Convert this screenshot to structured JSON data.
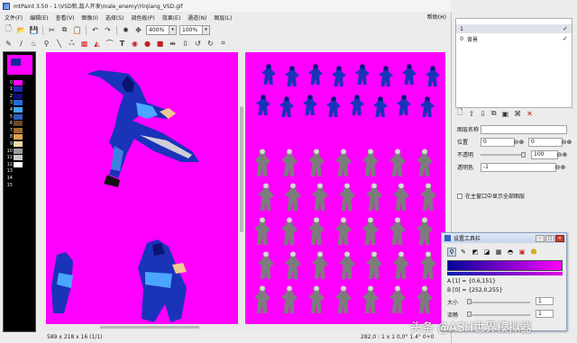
{
  "window": {
    "title": "mtPaint 3.50 - 1:\\VSD新,敌人开发\\male_enemy\\Yinjiang_VSD.gif",
    "help": "帮助(H)"
  },
  "menu": [
    "文件(F)",
    "编辑(E)",
    "查看(V)",
    "图像(I)",
    "选择(S)",
    "调色板(P)",
    "效果(E)",
    "通道(N)",
    "图层(L)"
  ],
  "toolbar": {
    "zoom_main": "400%",
    "zoom_view": "100%"
  },
  "palette": {
    "entries": [
      {
        "num": "0",
        "color": "#ff00ff"
      },
      {
        "num": "1",
        "color": "#1b2bb0"
      },
      {
        "num": "2",
        "color": "#0a0f7a"
      },
      {
        "num": "3",
        "color": "#1f6ee0"
      },
      {
        "num": "4",
        "color": "#43a4ff"
      },
      {
        "num": "5",
        "color": "#2f5fc0"
      },
      {
        "num": "6",
        "color": "#6b4a26"
      },
      {
        "num": "7",
        "color": "#a06a2c"
      },
      {
        "num": "8",
        "color": "#e0a050"
      },
      {
        "num": "9",
        "color": "#f4d8a8"
      },
      {
        "num": "10",
        "color": "#9c9c9c"
      },
      {
        "num": "11",
        "color": "#c8c8c8"
      },
      {
        "num": "12",
        "color": "#ffffff"
      },
      {
        "num": "13",
        "color": "#000000"
      },
      {
        "num": "14",
        "color": "#000000"
      },
      {
        "num": "15",
        "color": "#000000"
      }
    ]
  },
  "status": {
    "dims": "589 x 218 x 16  (1/1)",
    "coord": "282,0 : 1 x 1     0,0° 1.4°     0+0"
  },
  "layers": {
    "rows": [
      {
        "num": "1",
        "name": "",
        "check": "✓"
      },
      {
        "num": "0",
        "name": "背景",
        "check": "✓"
      }
    ]
  },
  "layer_props": {
    "name_label": "图层名称",
    "name_value": "",
    "position_label": "位置",
    "pos_x": "0",
    "pos_y": "0",
    "opacity_label": "不透明",
    "opacity_value": "100",
    "opacity_pct": 1.0,
    "transparent_label": "透明色",
    "transparent_value": "-1",
    "show_all_label": "在主窗口中显示全部图层"
  },
  "settings": {
    "title": "设置工具栏",
    "color_a": "A [1] = {0,6,151}",
    "color_b": "B [0] = {252,0,255}",
    "size_label": "大小",
    "size_value": "1",
    "flow_label": "流畅",
    "flow_value": "1"
  },
  "watermark": "头条 @ASH世界模拟器"
}
